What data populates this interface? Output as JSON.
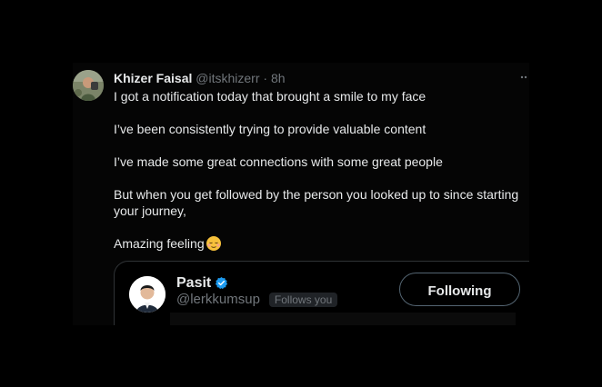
{
  "post": {
    "author": {
      "name": "Khizer Faisal",
      "handle": "@itskhizerr",
      "separator": "·",
      "time": "8h"
    },
    "paragraphs": [
      "I got a notification today that brought a smile to my face",
      "I’ve been consistently trying to provide valuable content",
      "I’ve made some great connections with some great people",
      "But when you get followed by the person you looked up to since starting your journey,"
    ],
    "last_paragraph": "Amazing feeling",
    "last_emoji": "relieved-face-emoji",
    "more_icon": "more-dots-icon"
  },
  "embedded_profile": {
    "name": "Pasit",
    "verified_icon": "verified-badge-icon",
    "handle": "@lerkkumsup",
    "badge": "Follows you",
    "button_label": "Following"
  },
  "colors": {
    "background": "#000000",
    "text_primary": "#e7e9ea",
    "text_secondary": "#71767b",
    "verified_blue": "#1d9bf0",
    "card_border": "#2f3336",
    "badge_bg": "#202327"
  }
}
